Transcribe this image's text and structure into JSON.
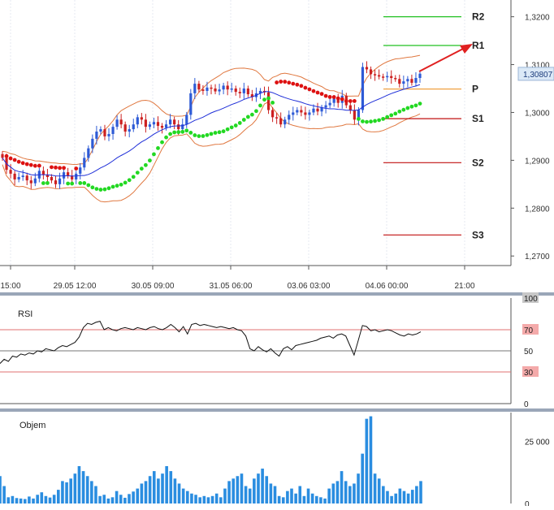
{
  "colors": {
    "candle_up": "#2e5bd6",
    "candle_down": "#cc2020",
    "ma": "#1f2fd8",
    "bollinger": "#e07840",
    "sar_up": "#22d822",
    "sar_down": "#dd1111",
    "pivot": "#f0a040",
    "resistance": "#20c020",
    "support": "#c01010",
    "rsi_line": "#111111",
    "rsi_bands": "#e07070",
    "volume": "#2a8de0",
    "price_badge": "#dbe9f7",
    "separator": "#9aa6b8"
  },
  "price_panel": {
    "y_ticks": [
      "1,3200",
      "1,3100",
      "1,3000",
      "1,2900",
      "1,2800",
      "1,2700"
    ],
    "current_price": "1,30807",
    "x_ticks": [
      "15:00",
      "29.05 12:00",
      "30.05 09:00",
      "31.05 06:00",
      "03.06 03:00",
      "04.06 00:00",
      "21:00"
    ],
    "pivot_labels": [
      "R2",
      "R1",
      "P",
      "S1",
      "S2",
      "S3"
    ]
  },
  "rsi_panel": {
    "title": "RSI",
    "ticks": [
      "100",
      "70",
      "50",
      "30",
      "0"
    ]
  },
  "volume_panel": {
    "title": "Objem",
    "ticks": [
      "25 000",
      "0"
    ]
  },
  "chart_data": [
    {
      "type": "candlestick",
      "x_labels": [
        "15:00",
        "29.05 12:00",
        "30.05 09:00",
        "31.05 06:00",
        "03.06 03:00",
        "04.06 00:00",
        "21:00"
      ],
      "ylim": [
        1.268,
        1.3235
      ],
      "close": [
        1.2905,
        1.288,
        1.2872,
        1.286,
        1.2865,
        1.2868,
        1.2858,
        1.2852,
        1.2862,
        1.2878,
        1.287,
        1.2865,
        1.2858,
        1.285,
        1.2862,
        1.2875,
        1.2868,
        1.286,
        1.2872,
        1.2885,
        1.2905,
        1.2925,
        1.2945,
        1.296,
        1.2965,
        1.295,
        1.2955,
        1.297,
        1.2985,
        1.2975,
        1.296,
        1.2965,
        1.2975,
        1.299,
        1.2985,
        1.297,
        1.2975,
        1.298,
        1.2972,
        1.2968,
        1.2975,
        1.2985,
        1.2975,
        1.2965,
        1.2975,
        1.2995,
        1.304,
        1.306,
        1.3048,
        1.3045,
        1.3052,
        1.305,
        1.3044,
        1.3048,
        1.3056,
        1.3048,
        1.305,
        1.3043,
        1.304,
        1.305,
        1.3038,
        1.3032,
        1.304,
        1.3045,
        1.3042,
        1.3005,
        1.299,
        1.2988,
        1.2975,
        1.2985,
        1.2995,
        1.3,
        1.3005,
        1.3,
        1.2995,
        1.3,
        1.3008,
        1.3002,
        1.301,
        1.3015,
        1.302,
        1.303,
        1.302,
        1.3035,
        1.3015,
        1.3005,
        1.2985,
        1.3005,
        1.3095,
        1.309,
        1.308,
        1.3078,
        1.3075,
        1.3074,
        1.3076,
        1.3072,
        1.307,
        1.306,
        1.3065,
        1.307,
        1.3062,
        1.3072,
        1.3081
      ],
      "sma": 20,
      "bollinger": {
        "period": 20,
        "stddev": 2
      },
      "parabolic_sar": true,
      "pivot_levels": {
        "R2": 1.32,
        "R1": 1.314,
        "P": 1.3049,
        "S1": 1.2987,
        "S2": 1.2895,
        "S3": 1.2744
      },
      "last_price": 1.30807
    },
    {
      "type": "line",
      "title": "RSI",
      "ylim": [
        0,
        100
      ],
      "levels": [
        70,
        50,
        30
      ],
      "values": [
        38,
        42,
        40,
        45,
        44,
        47,
        46,
        48,
        47,
        50,
        49,
        52,
        51,
        50,
        53,
        55,
        54,
        56,
        58,
        63,
        72,
        76,
        75,
        77,
        78,
        70,
        72,
        70,
        69,
        71,
        72,
        71,
        70,
        72,
        71,
        70,
        72,
        73,
        71,
        70,
        72,
        75,
        72,
        68,
        73,
        66,
        75,
        76,
        74,
        75,
        74,
        73,
        72,
        73,
        72,
        71,
        72,
        70,
        69,
        64,
        52,
        50,
        54,
        51,
        49,
        52,
        48,
        45,
        52,
        54,
        51,
        55,
        56,
        57,
        58,
        59,
        60,
        62,
        63,
        64,
        62,
        65,
        66,
        64,
        55,
        46,
        60,
        74,
        73,
        69,
        70,
        68,
        69,
        70,
        69,
        67,
        65,
        64,
        66,
        65,
        66,
        68
      ]
    },
    {
      "type": "bar",
      "title": "Objem",
      "ylim": [
        0,
        36500
      ],
      "values": [
        11000,
        7000,
        2500,
        3000,
        2200,
        2000,
        1800,
        2800,
        2000,
        3500,
        4500,
        3000,
        2400,
        3500,
        5500,
        9000,
        8500,
        10000,
        12000,
        15000,
        13000,
        11000,
        9000,
        7000,
        3000,
        3500,
        2000,
        2500,
        5000,
        3500,
        2300,
        3800,
        4800,
        6000,
        8000,
        9000,
        11000,
        13000,
        10000,
        12000,
        15000,
        13000,
        10000,
        8000,
        6000,
        5000,
        4000,
        3500,
        2500,
        3000,
        2500,
        3000,
        4000,
        2500,
        6000,
        9000,
        10000,
        11000,
        12000,
        7000,
        6000,
        10000,
        12000,
        14000,
        11000,
        8000,
        7000,
        3000,
        2500,
        5000,
        6000,
        4000,
        7000,
        3000,
        6000,
        4000,
        3000,
        2500,
        2000,
        6000,
        8000,
        9000,
        13000,
        9000,
        7000,
        8000,
        12000,
        20000,
        34000,
        35000,
        12000,
        10000,
        7000,
        5000,
        3000,
        4000,
        6000,
        5000,
        4000,
        5500,
        7000,
        9000
      ]
    }
  ]
}
